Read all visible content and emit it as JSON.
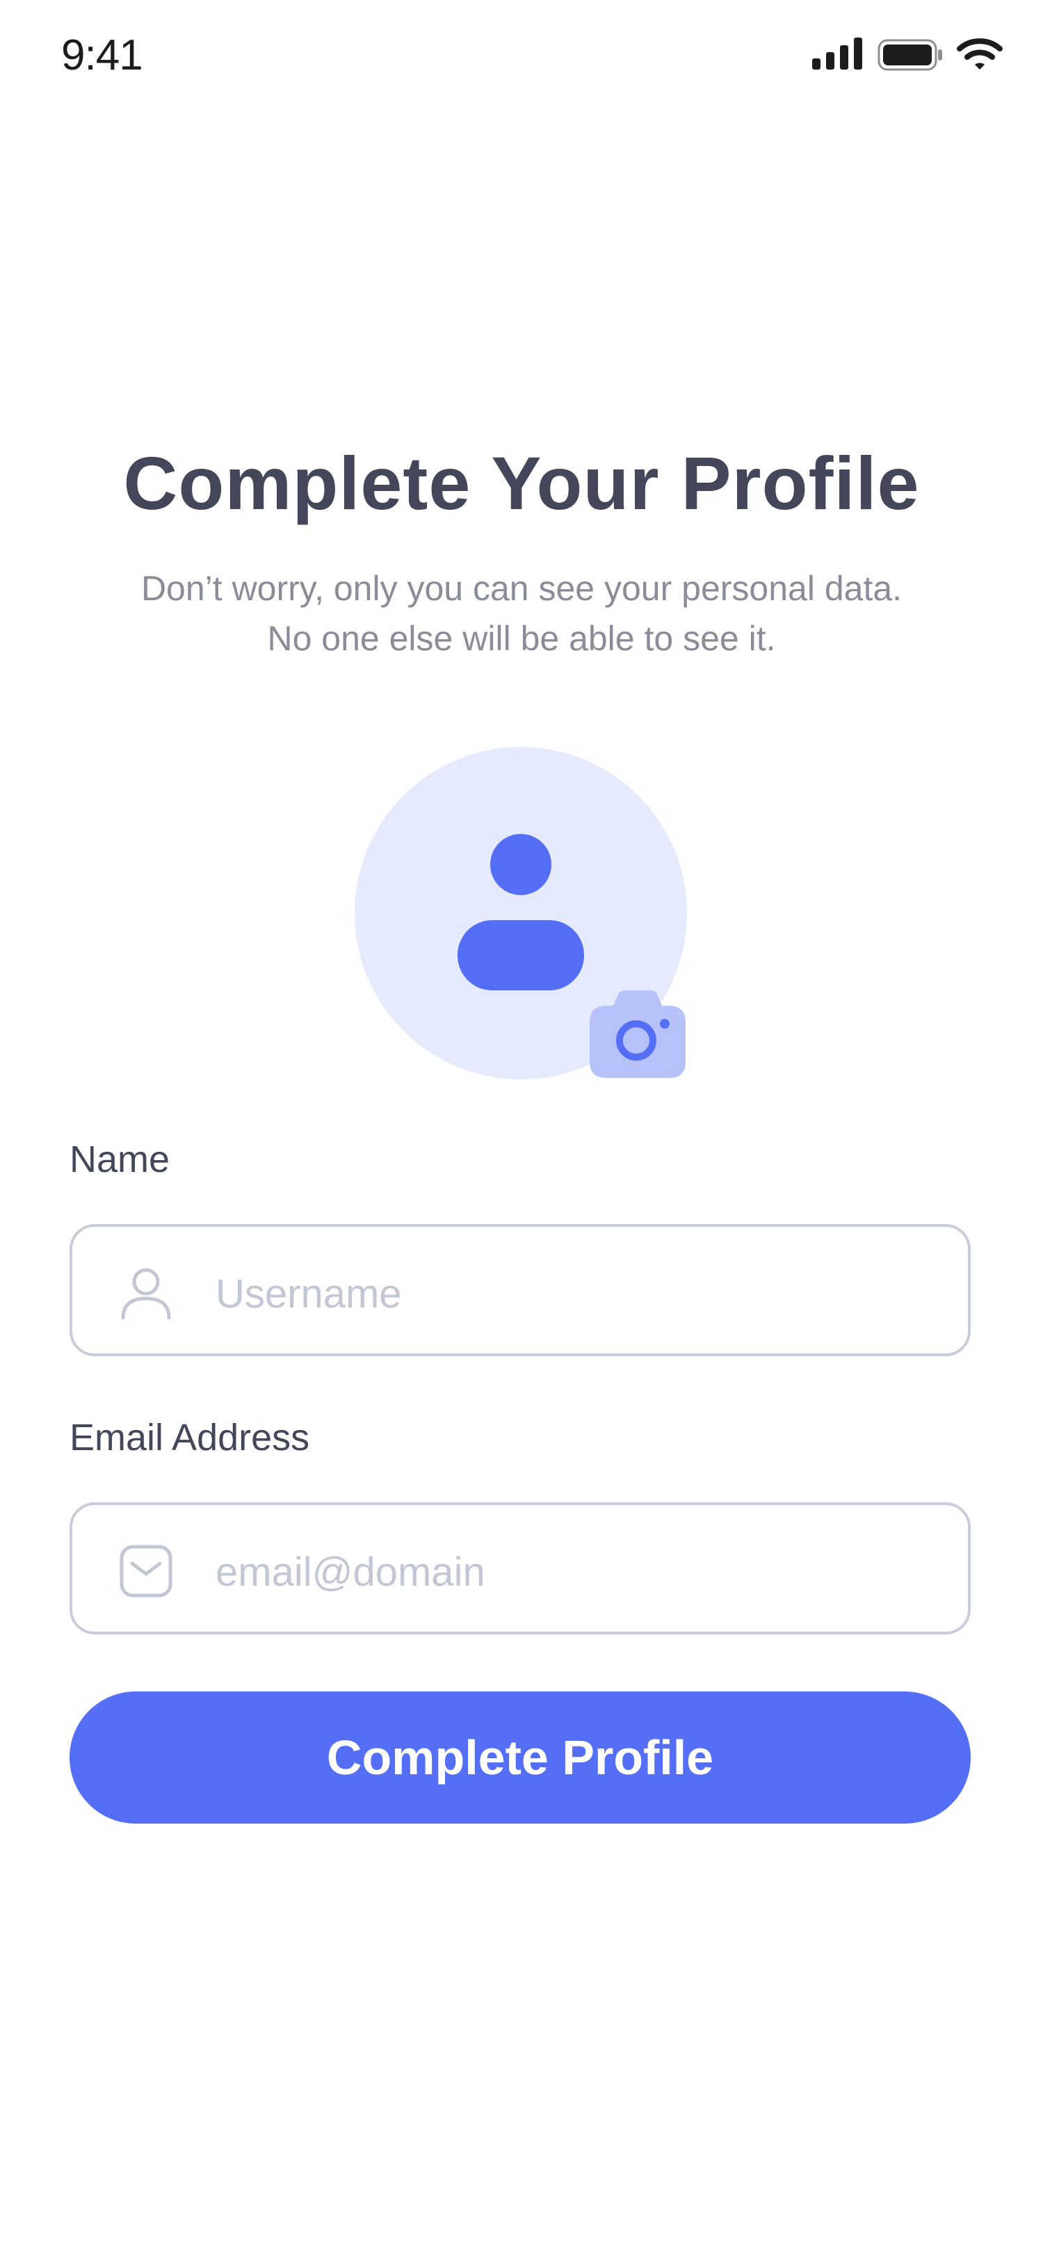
{
  "status_bar": {
    "time": "9:41",
    "icons": [
      "signal-icon",
      "battery-icon",
      "wifi-icon"
    ]
  },
  "header": {
    "title": "Complete Your Profile",
    "subtitle": "Don’t worry, only you can see your personal data. No one else will be able to see it."
  },
  "avatar": {
    "icon": "user-icon",
    "camera_icon": "camera-icon"
  },
  "form": {
    "name_label": "Name",
    "name_placeholder": "Username",
    "name_value": "",
    "name_icon": "user-outline-icon",
    "email_label": "Email Address",
    "email_placeholder": "email@domain",
    "email_value": "",
    "email_icon": "mail-icon",
    "submit_label": "Complete Profile"
  },
  "colors": {
    "accent": "#546ff5",
    "avatar_bg": "#e5eafd",
    "title": "#444759",
    "subtitle": "#8a8c98",
    "input_border": "#c9ccd9",
    "placeholder": "#c3c6d4"
  }
}
